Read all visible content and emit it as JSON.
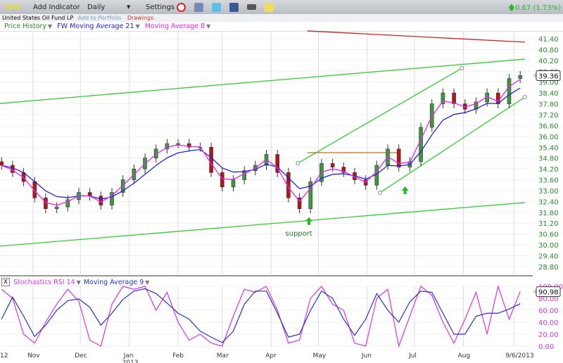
{
  "toolbar": {
    "symbol": "USO",
    "add_indicator": "Add Indicator",
    "interval": "Daily",
    "settings": "Settings",
    "change": "0.67 (1.73%)",
    "icons": [
      "alarm-clock-icon",
      "book-icon",
      "twitter-icon",
      "facebook-icon",
      "camera-icon",
      "sticky-note-icon"
    ]
  },
  "subbar": {
    "name": "United States Oil Fund LP",
    "add_portfolio": "Add to Portfolio",
    "drawings": "Drawings"
  },
  "legend": {
    "price": "Price History",
    "ma21": "FW Moving Average 21",
    "ma8": "Moving Average 8"
  },
  "stoch_legend": {
    "close": "X",
    "rsi": "Stochastics RSI 14",
    "ma": "Moving Average 9"
  },
  "colors": {
    "up": "#3c9a3c",
    "down": "#b01818",
    "ma21": "#2222dd",
    "ma8": "#ee22ee",
    "channel": "#33cc33",
    "red_line": "#cc2222",
    "stoch": "#dd33dd",
    "stoch_ma": "#2233cc",
    "axis_price": "#2a8a2a",
    "axis_stoch": "#dd33dd"
  },
  "annotations": {
    "support": "support"
  },
  "chart_data": [
    {
      "type": "candlestick",
      "title": "",
      "ylim": [
        28.8,
        41.4
      ],
      "yticks": [
        "41.40",
        "40.80",
        "40.20",
        "39.60",
        "39.00",
        "38.40",
        "37.80",
        "37.20",
        "36.60",
        "36.00",
        "35.40",
        "34.80",
        "34.20",
        "33.60",
        "33.00",
        "32.40",
        "31.80",
        "31.20",
        "30.60",
        "30.00",
        "29.40",
        "28.80"
      ],
      "last_price": "39.36",
      "dates": [
        "2012-10-12",
        "2012-10-19",
        "2012-10-26",
        "2012-11-02",
        "2012-11-09",
        "2012-11-16",
        "2012-11-23",
        "2012-11-30",
        "2012-12-07",
        "2012-12-14",
        "2012-12-21",
        "2012-12-28",
        "2013-01-04",
        "2013-01-11",
        "2013-01-18",
        "2013-01-25",
        "2013-02-01",
        "2013-02-08",
        "2013-02-15",
        "2013-02-22",
        "2013-03-01",
        "2013-03-08",
        "2013-03-15",
        "2013-03-22",
        "2013-03-29",
        "2013-04-05",
        "2013-04-12",
        "2013-04-19",
        "2013-04-26",
        "2013-05-03",
        "2013-05-10",
        "2013-05-17",
        "2013-05-24",
        "2013-05-31",
        "2013-06-07",
        "2013-06-14",
        "2013-06-21",
        "2013-06-28",
        "2013-07-05",
        "2013-07-12",
        "2013-07-19",
        "2013-07-26",
        "2013-08-02",
        "2013-08-09",
        "2013-08-16",
        "2013-08-23",
        "2013-08-30",
        "2013-09-06"
      ],
      "close": [
        34.4,
        34.0,
        33.5,
        32.6,
        32.0,
        32.1,
        32.5,
        32.9,
        32.7,
        32.2,
        32.9,
        33.6,
        34.2,
        34.8,
        35.3,
        35.6,
        35.6,
        35.4,
        35.4,
        34.0,
        33.2,
        33.6,
        34.1,
        34.4,
        35.0,
        34.0,
        32.6,
        32.0,
        33.5,
        34.5,
        34.3,
        34.0,
        33.6,
        33.3,
        34.4,
        35.3,
        34.3,
        34.6,
        36.5,
        37.8,
        38.4,
        37.8,
        37.5,
        37.9,
        38.4,
        37.8,
        39.2,
        39.36
      ],
      "trendlines": [
        {
          "color": "#33cc33",
          "points": [
            [
              "2012-10-11",
              29.93
            ],
            [
              "2013-09-09",
              32.34
            ]
          ]
        },
        {
          "color": "#33cc33",
          "points": [
            [
              "2012-10-11",
              37.82
            ],
            [
              "2013-09-09",
              40.27
            ]
          ]
        },
        {
          "color": "#cc2222",
          "points": [
            [
              "2013-04-24",
              41.83
            ],
            [
              "2013-09-09",
              41.21
            ]
          ]
        },
        {
          "color": "#33cc33",
          "points": [
            [
              "2013-04-18",
              34.52
            ],
            [
              "2013-07-31",
              39.77
            ]
          ],
          "end_markers": true
        },
        {
          "color": "#33cc33",
          "points": [
            [
              "2013-06-09",
              32.88
            ],
            [
              "2013-09-09",
              38.17
            ]
          ],
          "end_markers": true
        },
        {
          "color": "#b07030",
          "points": [
            [
              "2013-04-24",
              35.1
            ],
            [
              "2013-06-21",
              35.1
            ]
          ]
        }
      ],
      "arrows": [
        [
          "2013-04-25",
          31.3
        ],
        [
          "2013-06-25",
          33.0
        ]
      ],
      "support_label_at": [
        "2013-04-10",
        30.5
      ]
    },
    {
      "type": "line",
      "title": "",
      "ylim": [
        0,
        100
      ],
      "yticks": [
        "100.00",
        "80.00",
        "60.00",
        "40.00",
        "20.00",
        "0.00"
      ],
      "last_value": "90.98",
      "series": [
        {
          "name": "Stochastics RSI 14",
          "values": [
            95,
            80,
            20,
            5,
            40,
            70,
            95,
            75,
            10,
            0,
            70,
            100,
            95,
            100,
            60,
            90,
            40,
            10,
            20,
            5,
            0,
            50,
            95,
            90,
            100,
            60,
            5,
            10,
            80,
            100,
            70,
            60,
            5,
            0,
            80,
            95,
            0,
            50,
            100,
            85,
            40,
            5,
            45,
            90,
            20,
            100,
            45,
            90.98
          ]
        },
        {
          "name": "Moving Average 9",
          "values": [
            45,
            82,
            50,
            16,
            35,
            60,
            76,
            79,
            65,
            35,
            55,
            78,
            92,
            96,
            88,
            72,
            55,
            45,
            25,
            15,
            6,
            25,
            70,
            92,
            92,
            55,
            15,
            20,
            60,
            92,
            80,
            45,
            18,
            45,
            88,
            60,
            40,
            74,
            92,
            90,
            55,
            20,
            20,
            50,
            55,
            55,
            62,
            71
          ]
        }
      ],
      "xticks": [
        {
          "label": "12",
          "date": "2012-10-13"
        },
        {
          "label": "Nov",
          "date": "2012-11-01"
        },
        {
          "label": "Dec",
          "date": "2012-12-01"
        },
        {
          "label": "Jan",
          "date": "2013-01-01",
          "sub": "2013"
        },
        {
          "label": "Feb",
          "date": "2013-02-01"
        },
        {
          "label": "Mar",
          "date": "2013-03-01"
        },
        {
          "label": "Apr",
          "date": "2013-04-01"
        },
        {
          "label": "May",
          "date": "2013-05-01"
        },
        {
          "label": "Jun",
          "date": "2013-06-01"
        },
        {
          "label": "Jul",
          "date": "2013-07-01"
        },
        {
          "label": "Aug",
          "date": "2013-08-01"
        },
        {
          "label": "9/6/2013",
          "date": "2013-09-02"
        }
      ]
    }
  ]
}
